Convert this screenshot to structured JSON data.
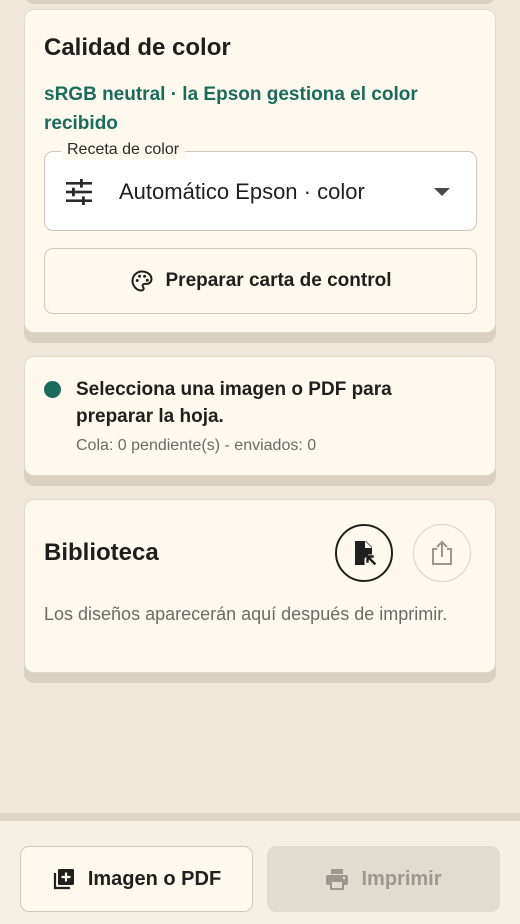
{
  "color_card": {
    "title": "Calidad de color",
    "subtitle": "sRGB neutral · la Epson gestiona el color recibido",
    "recipe_label": "Receta de color",
    "recipe_value": "Automático Epson · color",
    "control_chart_button": "Preparar carta de control"
  },
  "status_card": {
    "message": "Selecciona una imagen o PDF para preparar la hoja.",
    "queue": "Cola: 0 pendiente(s) - enviados: 0"
  },
  "library_card": {
    "title": "Biblioteca",
    "empty_text": "Los diseños aparecerán aquí después de imprimir."
  },
  "bottom_bar": {
    "add_button": "Imagen o PDF",
    "print_button": "Imprimir"
  },
  "colors": {
    "accent": "#1a6b5c",
    "background": "#efe7da",
    "card": "#fdf9ee"
  }
}
